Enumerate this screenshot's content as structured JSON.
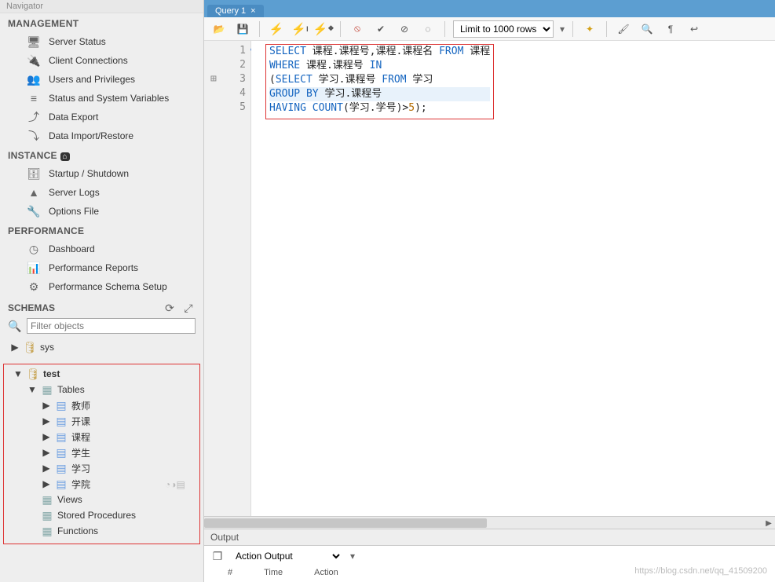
{
  "sidebar": {
    "panel_title": "Navigator",
    "management": {
      "header": "MANAGEMENT",
      "items": [
        {
          "label": "Server Status"
        },
        {
          "label": "Client Connections"
        },
        {
          "label": "Users and Privileges"
        },
        {
          "label": "Status and System Variables"
        },
        {
          "label": "Data Export"
        },
        {
          "label": "Data Import/Restore"
        }
      ]
    },
    "instance": {
      "header": "INSTANCE",
      "items": [
        {
          "label": "Startup / Shutdown"
        },
        {
          "label": "Server Logs"
        },
        {
          "label": "Options File"
        }
      ]
    },
    "performance": {
      "header": "PERFORMANCE",
      "items": [
        {
          "label": "Dashboard"
        },
        {
          "label": "Performance Reports"
        },
        {
          "label": "Performance Schema Setup"
        }
      ]
    },
    "schemas": {
      "header": "SCHEMAS",
      "filter_placeholder": "Filter objects",
      "tree": {
        "sys_label": "sys",
        "test_label": "test",
        "tables_label": "Tables",
        "tables": [
          "教师",
          "开课",
          "课程",
          "学生",
          "学习",
          "学院"
        ],
        "views_label": "Views",
        "sp_label": "Stored Procedures",
        "fn_label": "Functions"
      }
    }
  },
  "main": {
    "tab_label": "Query 1",
    "toolbar": {
      "limit_label": "Limit to 1000 rows"
    },
    "sql": {
      "line1": {
        "select": "SELECT",
        "cols": "课程.课程号,课程.课程名",
        "from": "FROM",
        "tbl": "课程"
      },
      "line2": {
        "where": "WHERE",
        "expr": "课程.课程号",
        "in": "IN"
      },
      "line3": {
        "open": "(",
        "select": "SELECT",
        "cols": "学习.课程号",
        "from": "FROM",
        "tbl": "学习"
      },
      "line4": {
        "group": "GROUP",
        "by": "BY",
        "expr": "学习.课程号"
      },
      "line5": {
        "having": "HAVING",
        "count": "COUNT",
        "open": "(",
        "arg": "学习.学号",
        "close": ")>",
        "num": "5",
        "end": ");"
      }
    },
    "gutter": [
      "1",
      "2",
      "3",
      "4",
      "5"
    ],
    "output": {
      "title": "Output",
      "dropdown": "Action Output",
      "cols": {
        "num": "#",
        "time": "Time",
        "action": "Action"
      }
    }
  },
  "watermark": "https://blog.csdn.net/qq_41509200"
}
